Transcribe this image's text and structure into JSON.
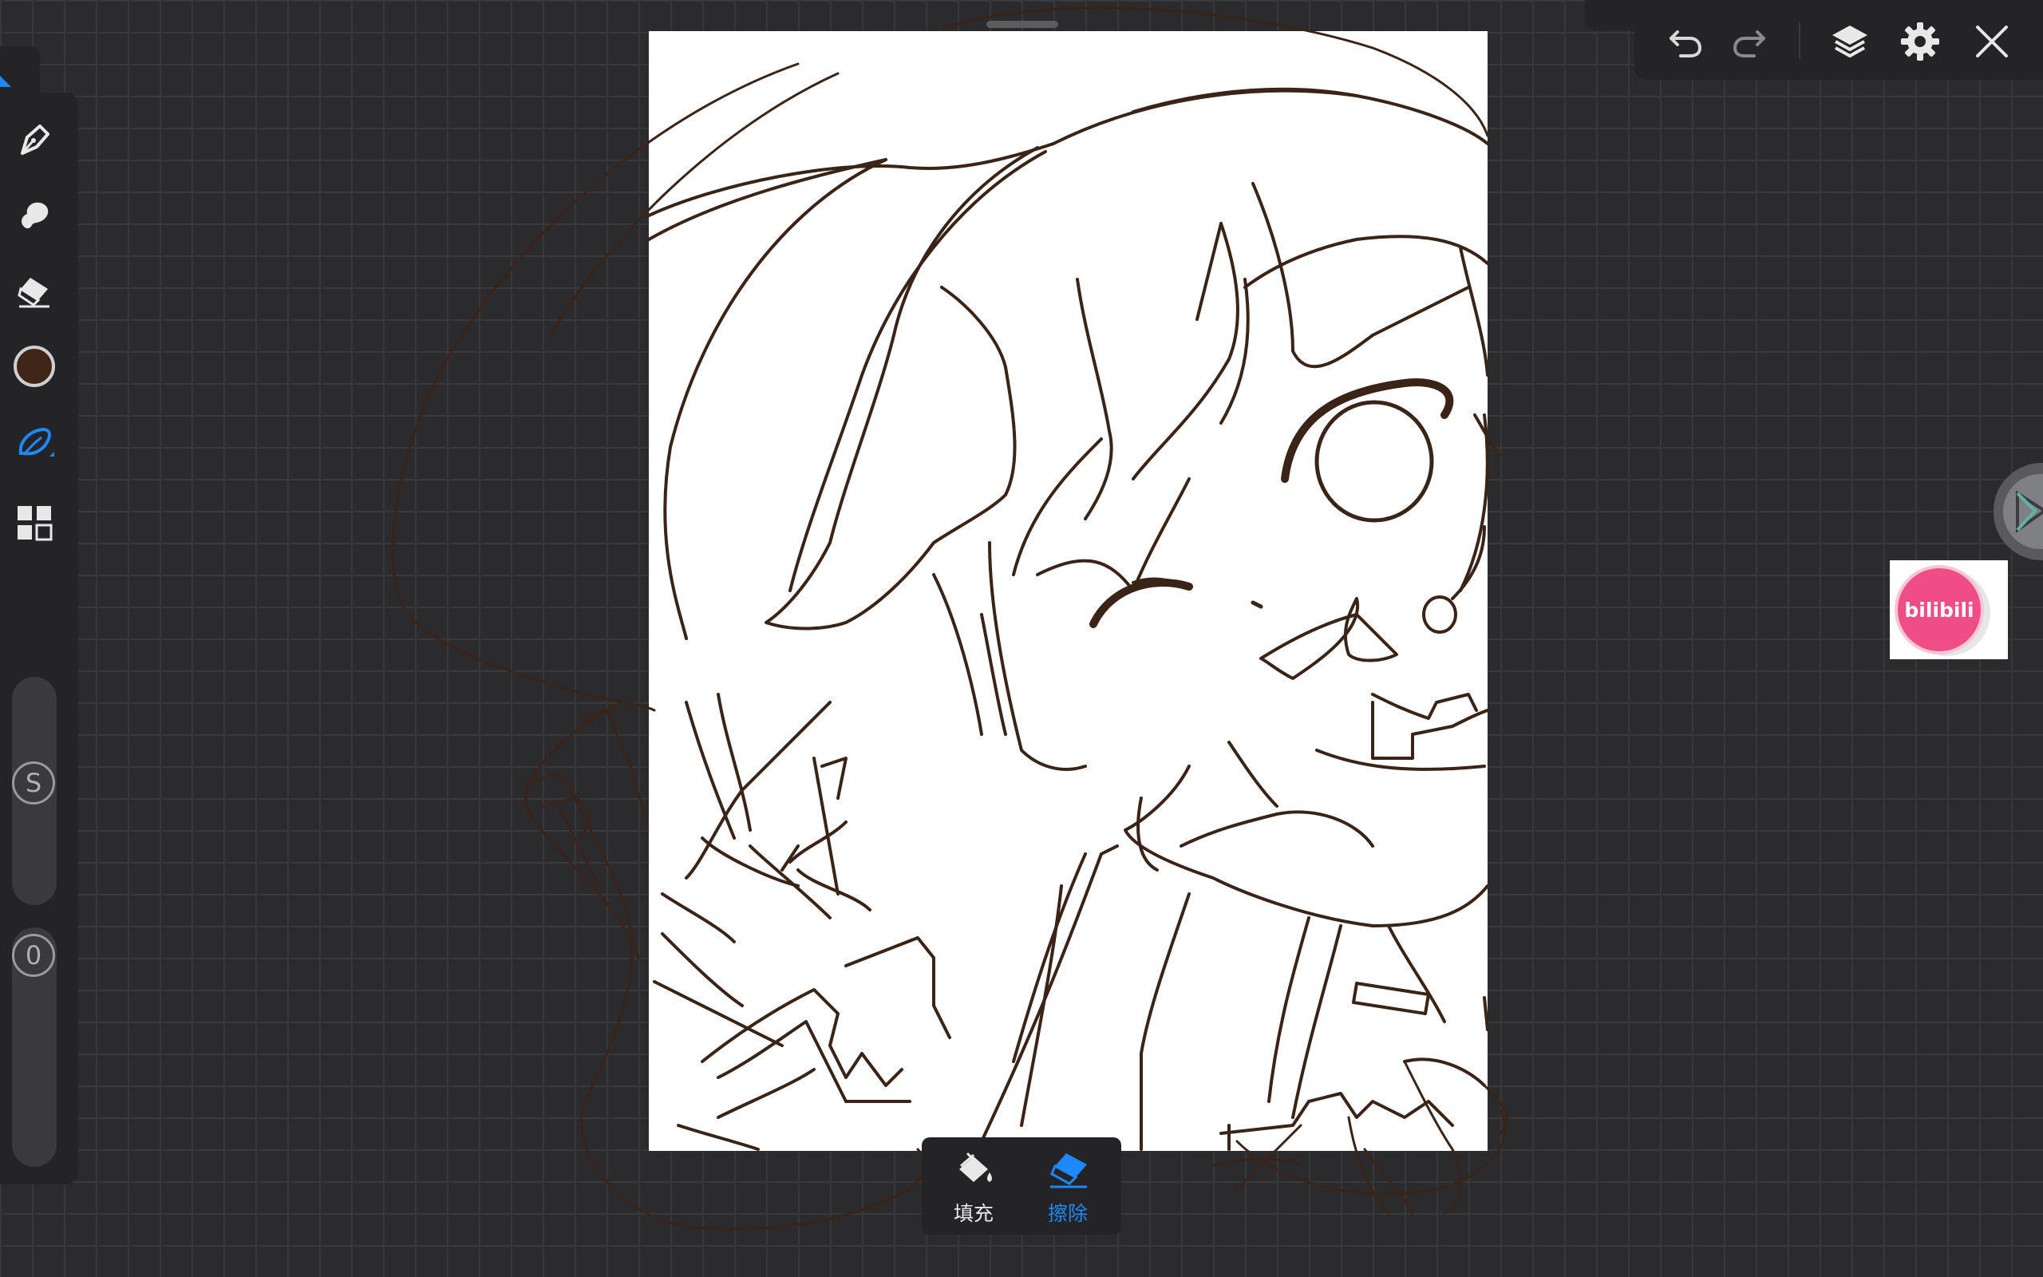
{
  "app": {
    "accent_color": "#1e88ff",
    "brush_color": "#3f2418",
    "canvas_color": "#ffffff",
    "line_color": "#3a2418"
  },
  "toolbar_left": {
    "tools": [
      {
        "name": "pen-icon",
        "active": false
      },
      {
        "name": "smudge-icon",
        "active": false
      },
      {
        "name": "eraser-icon",
        "active": false
      },
      {
        "name": "color-swatch",
        "active": false
      },
      {
        "name": "lasso-icon",
        "active": true
      },
      {
        "name": "grid-menu-icon",
        "active": false
      }
    ],
    "size_label": "S",
    "opacity_label": "0"
  },
  "topbar": {
    "buttons": [
      "undo-icon",
      "redo-icon",
      "layers-icon",
      "settings-icon",
      "close-icon"
    ]
  },
  "floating": {
    "bilibili_label": "bilibili"
  },
  "bottom_popup": {
    "fill_label": "填充",
    "erase_label": "擦除",
    "active": "erase"
  }
}
